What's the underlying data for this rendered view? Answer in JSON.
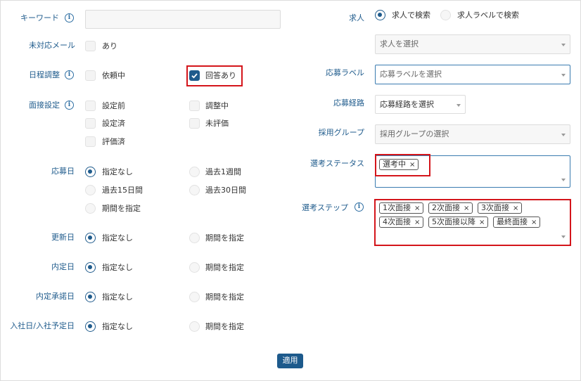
{
  "left": {
    "keyword": {
      "label": "キーワード",
      "value": ""
    },
    "unhandled_mail": {
      "label": "未対応メール",
      "option": "あり"
    },
    "schedule": {
      "label": "日程調整",
      "options": [
        "依頼中",
        "回答あり"
      ]
    },
    "interview_setting": {
      "label": "面接設定",
      "options": [
        "設定前",
        "調整中",
        "設定済",
        "未評価",
        "評価済"
      ]
    },
    "applied_date": {
      "label": "応募日",
      "options": [
        "指定なし",
        "過去1週間",
        "過去15日間",
        "過去30日間",
        "期間を指定"
      ]
    },
    "updated_date": {
      "label": "更新日",
      "options": [
        "指定なし",
        "期間を指定"
      ]
    },
    "offer_date": {
      "label": "内定日",
      "options": [
        "指定なし",
        "期間を指定"
      ]
    },
    "offer_accept_date": {
      "label": "内定承諾日",
      "options": [
        "指定なし",
        "期間を指定"
      ]
    },
    "join_date": {
      "label": "入社日/入社予定日",
      "options": [
        "指定なし",
        "期間を指定"
      ]
    }
  },
  "right": {
    "job": {
      "label": "求人",
      "options": [
        "求人で検索",
        "求人ラベルで検索"
      ],
      "select_placeholder": "求人を選択"
    },
    "applicant_label": {
      "label": "応募ラベル",
      "placeholder": "応募ラベルを選択"
    },
    "route": {
      "label": "応募経路",
      "placeholder": "応募経路を選択"
    },
    "group": {
      "label": "採用グループ",
      "placeholder": "採用グループの選択"
    },
    "status": {
      "label": "選考ステータス",
      "tags": [
        "選考中"
      ]
    },
    "step": {
      "label": "選考ステップ",
      "tags": [
        "1次面接",
        "2次面接",
        "3次面接",
        "4次面接",
        "5次面接以降",
        "最終面接"
      ]
    }
  },
  "apply_label": "適用",
  "colors": {
    "accent": "#1f5b8c",
    "highlight": "#d4151b"
  },
  "icons": {
    "info": "i",
    "remove": "×",
    "check": "check"
  }
}
